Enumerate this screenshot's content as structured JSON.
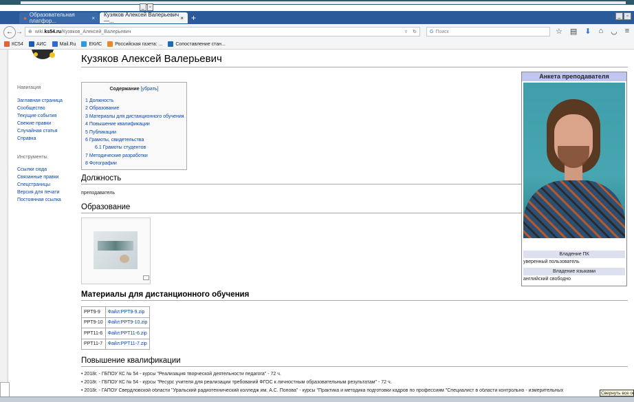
{
  "browser": {
    "tabs": [
      {
        "label": "Образовательная платфор...",
        "active": false
      },
      {
        "label": "Кузяков Алексей Валерьевич —...",
        "active": true
      }
    ],
    "url_prefix": "wiki.",
    "url_domain": "ks54.ru",
    "url_path": "/Кузяков_Алексей_Валерьевич",
    "search_placeholder": "Поиск",
    "bookmarks": [
      "КС54",
      "АИС",
      "Mail.Ru",
      "ЕКИС",
      "Российская газета: ...",
      "Сопоставление стан..."
    ],
    "bookmark_colors": [
      "#e0633a",
      "#1a5db5",
      "#2f6ad3",
      "#2f9ad9",
      "#e88a2b",
      "#1d6bb5"
    ]
  },
  "sidebar": {
    "nav_heading": "Навигация",
    "nav_items": [
      "Заглавная страница",
      "Сообщество",
      "Текущие события",
      "Свежие правки",
      "Случайная статья",
      "Справка"
    ],
    "tools_heading": "Инструменты",
    "tool_items": [
      "Ссылки сюда",
      "Связанные правки",
      "Спецстраницы",
      "Версия для печати",
      "Постоянная ссылка"
    ]
  },
  "page": {
    "title": "Кузяков Алексей Валерьевич",
    "toc_title": "Содержание",
    "toc_hide": "[убрать]",
    "toc": [
      {
        "text": "1 Должность",
        "sub": false
      },
      {
        "text": "2 Образование",
        "sub": false
      },
      {
        "text": "3 Материалы для дистанционного обучения",
        "sub": false
      },
      {
        "text": "4 Повышение квалификации",
        "sub": false
      },
      {
        "text": "5 Публикации",
        "sub": false
      },
      {
        "text": "6 Грамоты, свидетельства",
        "sub": false
      },
      {
        "text": "6.1 Грамоты студентов",
        "sub": true
      },
      {
        "text": "7 Методические разработки",
        "sub": false
      },
      {
        "text": "8 Фотографии",
        "sub": false
      }
    ],
    "sec_position": "Должность",
    "position_value": "преподаватель",
    "sec_education": "Образование",
    "sec_materials": "Материалы для дистанционного обучения",
    "materials": [
      {
        "code": "PPT9-9",
        "file": "Файл:PPT9-9.zip"
      },
      {
        "code": "PPT9-10",
        "file": "Файл:PPT9-10.zip"
      },
      {
        "code": "PPT11-6",
        "file": "Файл:PPT11-6.zip"
      },
      {
        "code": "PPT11-7",
        "file": "Файл:PPT11-7.zip"
      }
    ],
    "sec_qualification": "Повышение квалификации",
    "qualifications": [
      "2018г. - ГБПОУ КС № 54 - курсы \"Реализация творческой деятельности педагога\" - 72 ч.",
      "2018г. - ГБПОУ КС № 54 - курсы \"Ресурс учителя для реализации требований ФГОС к личностным образовательным результатам\" - 72 ч.",
      "2018г. - ГАПОУ Свердловской области \"Уральский радиотехнический колледж им. А.С. Попова\" - курсы \"Практика и методика подготовки кадров по профессиям \"Специалист в области контрольно - измерительных"
    ]
  },
  "infobox": {
    "title": "Анкета преподавателя",
    "pc_label": "Владение ПК",
    "pc_value": "уверенный пользователь",
    "lang_label": "Владение языками",
    "lang_value": "английский свободно"
  },
  "popup": "Свернуть все окна"
}
